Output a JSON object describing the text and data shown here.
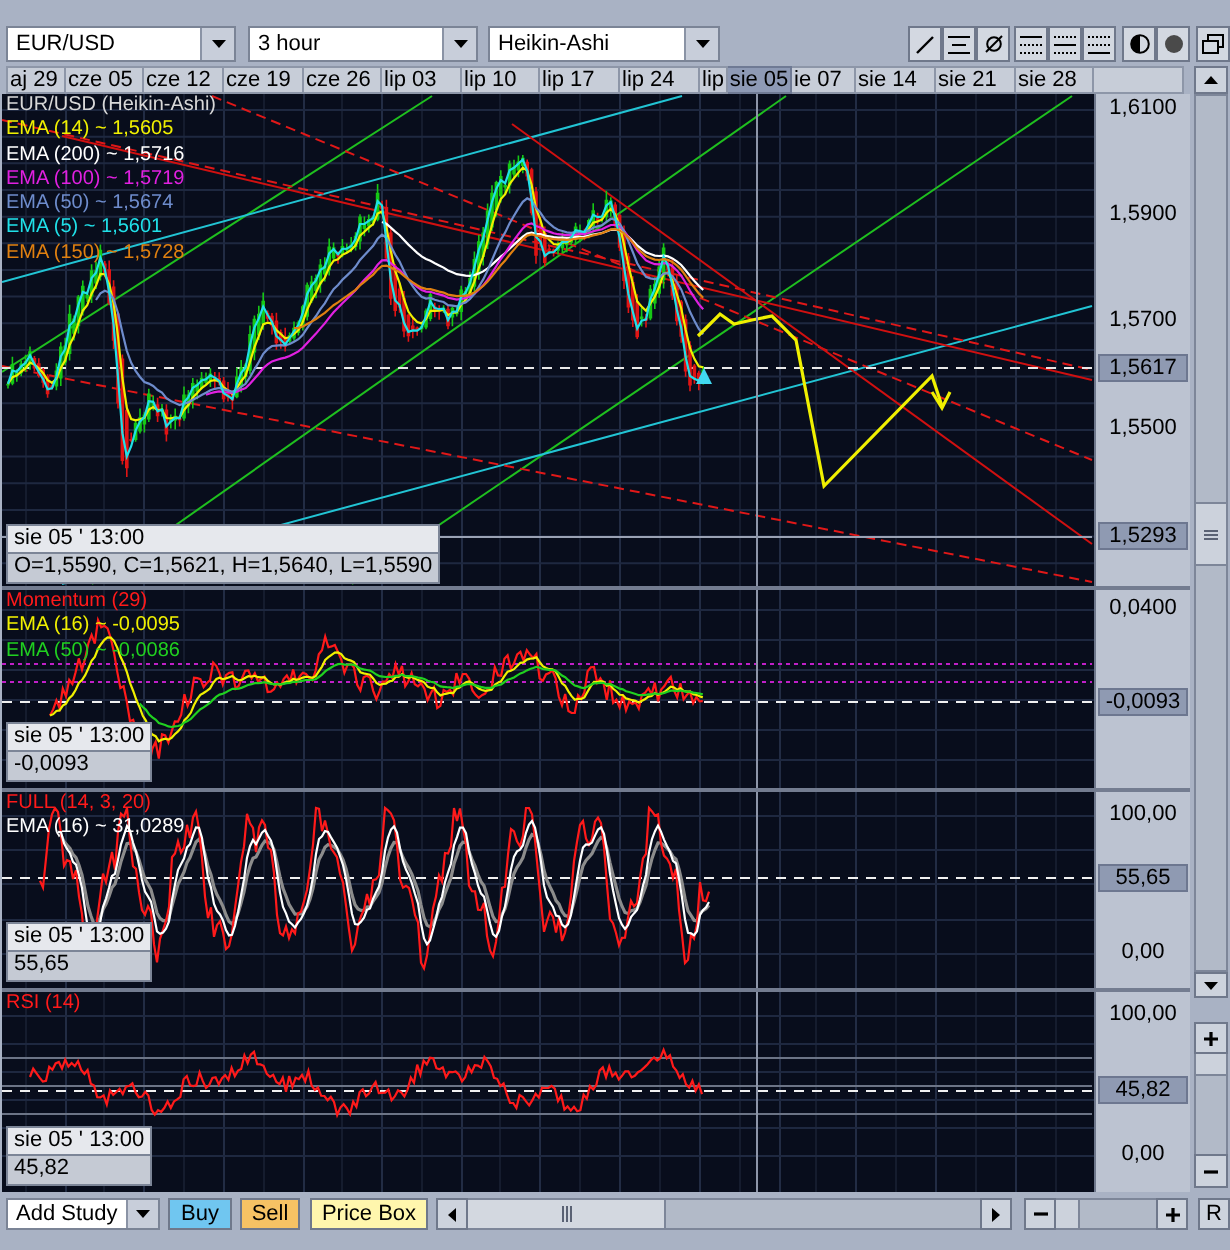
{
  "toolbar": {
    "symbol": {
      "value": "EUR/USD"
    },
    "interval": {
      "value": "3 hour"
    },
    "chart_style": {
      "value": "Heikin-Ashi"
    }
  },
  "date_axis": {
    "labels": [
      "aj 29",
      "cze 05",
      "cze 12",
      "cze 19",
      "cze 26",
      "lip 03",
      "lip 10",
      "lip 17",
      "lip 24",
      "lip",
      "ie 07",
      "sie 14",
      "sie 21",
      "sie 28"
    ],
    "cursor_date": "sie 05"
  },
  "panels": [
    {
      "kind": "price",
      "legend": [
        {
          "text": "EUR/USD (Heikin-Ashi)",
          "color": "#d8d8d8"
        },
        {
          "text": "EMA (14) ~ 1,5605",
          "color": "#f0f000"
        },
        {
          "text": "EMA (200) ~ 1,5716",
          "color": "#ffffff"
        },
        {
          "text": "EMA (100) ~ 1,5719",
          "color": "#e020e0"
        },
        {
          "text": "EMA (50) ~ 1,5674",
          "color": "#6e8ccc"
        },
        {
          "text": "EMA (5) ~ 1,5601",
          "color": "#20e0e8"
        },
        {
          "text": "EMA (150) ~ 1,5728",
          "color": "#e08010"
        }
      ],
      "cursor_info": {
        "time": "sie 05 ' 13:00",
        "values": "O=1,5590, C=1,5621, H=1,5640, L=1,5590"
      },
      "axis_labels": [
        "1,6100",
        "1,5900",
        "1,5700",
        "1,5500"
      ],
      "axis_markers": [
        "1,5617",
        "1,5293"
      ]
    },
    {
      "kind": "momentum",
      "legend": [
        {
          "text": "Momentum (29)",
          "color": "#ff1a1a"
        },
        {
          "text": "EMA (16) ~ -0,0095",
          "color": "#f0f000"
        },
        {
          "text": "EMA (50) ~ -0,0086",
          "color": "#20d020"
        }
      ],
      "cursor_info": {
        "time": "sie 05 ' 13:00",
        "values": "-0,0093"
      },
      "axis_labels": [
        "0,0400"
      ],
      "axis_markers": [
        "-0,0093"
      ]
    },
    {
      "kind": "full",
      "legend": [
        {
          "text": "FULL (14, 3, 20)",
          "color": "#ff1a1a"
        },
        {
          "text": "EMA (16) ~ 31,0289",
          "color": "#ffffff"
        }
      ],
      "cursor_info": {
        "time": "sie 05 ' 13:00",
        "values": "55,65"
      },
      "axis_labels": [
        "100,00",
        "0,00"
      ],
      "axis_markers": [
        "55,65"
      ]
    },
    {
      "kind": "rsi",
      "legend": [
        {
          "text": "RSI (14)",
          "color": "#ff1a1a"
        }
      ],
      "cursor_info": {
        "time": "sie 05 ' 13:00",
        "values": "45,82"
      },
      "axis_labels": [
        "100,00",
        "0,00"
      ],
      "axis_markers": [
        "45,82"
      ]
    }
  ],
  "bottom_bar": {
    "study_select": {
      "value": "Add Study"
    },
    "buy_button": {
      "label": "Buy"
    },
    "sell_button": {
      "label": "Sell"
    },
    "price_box_button": {
      "label": "Price Box"
    },
    "reset_button": {
      "label": "R"
    }
  }
}
